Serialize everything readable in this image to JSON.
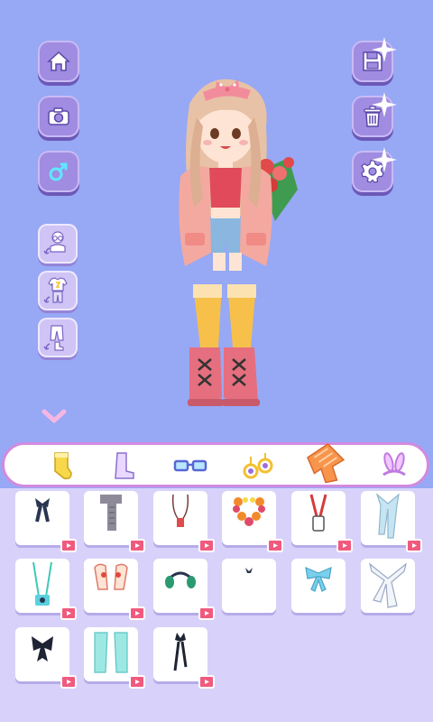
{
  "app": {
    "screen": "dress-up"
  },
  "left_buttons": [
    {
      "id": "home",
      "icon": "home-icon"
    },
    {
      "id": "camera",
      "icon": "camera-icon"
    },
    {
      "id": "gender",
      "icon": "gender-switch-icon"
    }
  ],
  "right_buttons": [
    {
      "id": "save",
      "icon": "floppy-disk-icon"
    },
    {
      "id": "delete",
      "icon": "trash-icon"
    },
    {
      "id": "settings",
      "icon": "gear-icon"
    }
  ],
  "randomize_buttons": [
    {
      "id": "random-accessories",
      "icon": "glasses-shuffle-icon"
    },
    {
      "id": "random-outfit",
      "icon": "outfit-shuffle-icon"
    },
    {
      "id": "random-bottoms",
      "icon": "pants-shuffle-icon"
    }
  ],
  "collapse_icon": "chevron-down-icon",
  "category_tabs": [
    {
      "id": "socks",
      "icon": "sock-icon"
    },
    {
      "id": "shoes",
      "icon": "boot-icon"
    },
    {
      "id": "glasses",
      "icon": "glasses-icon"
    },
    {
      "id": "earrings",
      "icon": "earring-icon"
    },
    {
      "id": "scarves",
      "icon": "scarf-icon",
      "active": true
    },
    {
      "id": "headwear",
      "icon": "bunny-ears-icon"
    }
  ],
  "items": [
    {
      "name": "black-bow-tie",
      "locked": true
    },
    {
      "name": "gray-knit-scarf",
      "locked": true
    },
    {
      "name": "red-pendant-necklace",
      "locked": true
    },
    {
      "name": "flower-lei",
      "locked": true
    },
    {
      "name": "red-lanyard-badge",
      "locked": true
    },
    {
      "name": "blue-long-scarf",
      "locked": true
    },
    {
      "name": "camera-strap",
      "locked": true
    },
    {
      "name": "bunny-hood-scarf",
      "locked": true
    },
    {
      "name": "headphones",
      "locked": true
    },
    {
      "name": "black-choker",
      "locked": false
    },
    {
      "name": "blue-ribbon-bow",
      "locked": false
    },
    {
      "name": "white-collar-scarf",
      "locked": false
    },
    {
      "name": "black-bow",
      "locked": false
    },
    {
      "name": "mint-cape",
      "locked": true
    },
    {
      "name": "black-ribbon-tie",
      "locked": true
    }
  ],
  "colors": {
    "background": "#97a8f5",
    "button": "#a08ce0",
    "tab_border": "#d28ae0",
    "panel": "#d8d2fa",
    "ad_badge": "#f05a7e"
  }
}
